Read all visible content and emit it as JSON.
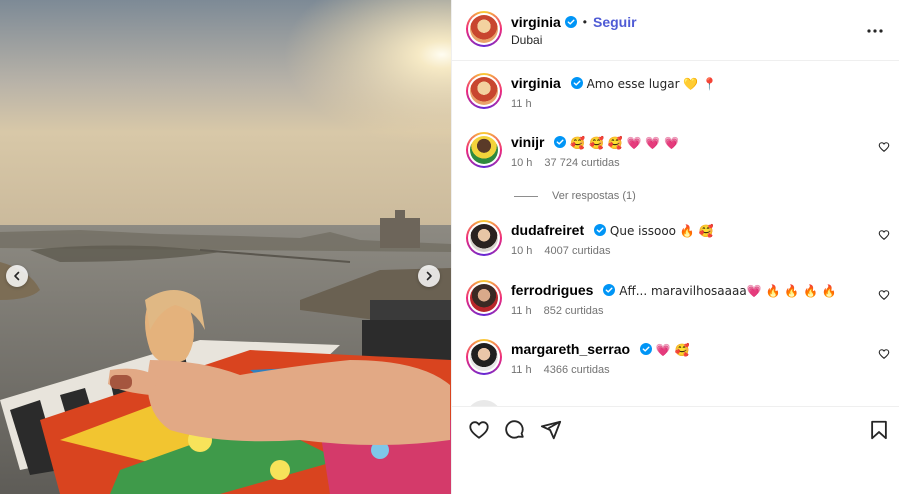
{
  "post": {
    "username": "virginia",
    "dot": "•",
    "follow_label": "Seguir",
    "location": "Dubai"
  },
  "comments": [
    {
      "username": "virginia",
      "text": "Amo esse lugar 💛 📍",
      "time": "11 h",
      "likes": ""
    },
    {
      "username": "vinijr",
      "text": "🥰 🥰 🥰 💗 💗 💗",
      "time": "10 h",
      "likes": "37 724 curtidas"
    },
    {
      "username": "dudafreiret",
      "text": "Que issooo 🔥 🥰",
      "time": "10 h",
      "likes": "4007 curtidas"
    },
    {
      "username": "ferrodrigues",
      "text": "Aff... maravilhosaaaa💗 🔥 🔥 🔥 🔥",
      "time": "11 h",
      "likes": "852 curtidas"
    },
    {
      "username": "margareth_serrao",
      "text": "💗 🥰",
      "time": "11 h",
      "likes": "4366 curtidas"
    }
  ],
  "replies_label": "Ver respostas (1)",
  "icons": {
    "verified": "verified-badge-icon",
    "more": "more-options-icon",
    "like": "heart-icon",
    "comment": "comment-icon",
    "share": "share-icon",
    "save": "bookmark-icon",
    "prev": "chevron-left-icon",
    "next": "chevron-right-icon"
  },
  "colors": {
    "follow": "#4f5bd5",
    "verified": "#0095f6",
    "muted": "#737373"
  }
}
